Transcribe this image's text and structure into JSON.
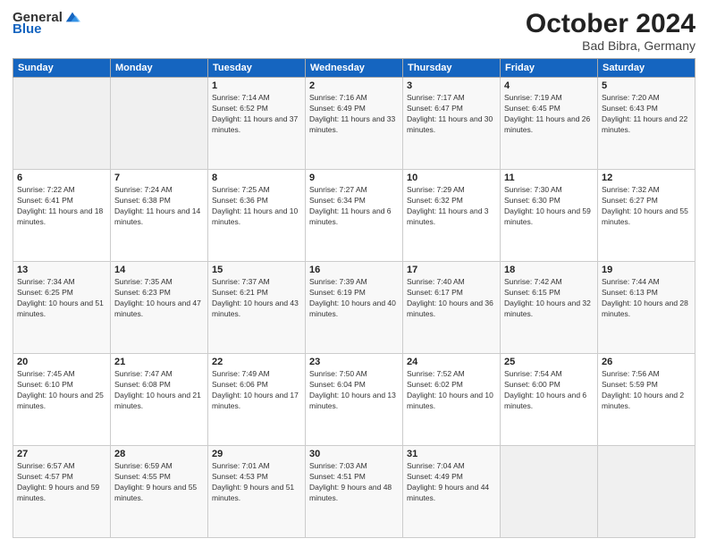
{
  "header": {
    "logo_general": "General",
    "logo_blue": "Blue",
    "month": "October 2024",
    "location": "Bad Bibra, Germany"
  },
  "days_of_week": [
    "Sunday",
    "Monday",
    "Tuesday",
    "Wednesday",
    "Thursday",
    "Friday",
    "Saturday"
  ],
  "weeks": [
    [
      {
        "day": "",
        "info": ""
      },
      {
        "day": "",
        "info": ""
      },
      {
        "day": "1",
        "info": "Sunrise: 7:14 AM\nSunset: 6:52 PM\nDaylight: 11 hours and 37 minutes."
      },
      {
        "day": "2",
        "info": "Sunrise: 7:16 AM\nSunset: 6:49 PM\nDaylight: 11 hours and 33 minutes."
      },
      {
        "day": "3",
        "info": "Sunrise: 7:17 AM\nSunset: 6:47 PM\nDaylight: 11 hours and 30 minutes."
      },
      {
        "day": "4",
        "info": "Sunrise: 7:19 AM\nSunset: 6:45 PM\nDaylight: 11 hours and 26 minutes."
      },
      {
        "day": "5",
        "info": "Sunrise: 7:20 AM\nSunset: 6:43 PM\nDaylight: 11 hours and 22 minutes."
      }
    ],
    [
      {
        "day": "6",
        "info": "Sunrise: 7:22 AM\nSunset: 6:41 PM\nDaylight: 11 hours and 18 minutes."
      },
      {
        "day": "7",
        "info": "Sunrise: 7:24 AM\nSunset: 6:38 PM\nDaylight: 11 hours and 14 minutes."
      },
      {
        "day": "8",
        "info": "Sunrise: 7:25 AM\nSunset: 6:36 PM\nDaylight: 11 hours and 10 minutes."
      },
      {
        "day": "9",
        "info": "Sunrise: 7:27 AM\nSunset: 6:34 PM\nDaylight: 11 hours and 6 minutes."
      },
      {
        "day": "10",
        "info": "Sunrise: 7:29 AM\nSunset: 6:32 PM\nDaylight: 11 hours and 3 minutes."
      },
      {
        "day": "11",
        "info": "Sunrise: 7:30 AM\nSunset: 6:30 PM\nDaylight: 10 hours and 59 minutes."
      },
      {
        "day": "12",
        "info": "Sunrise: 7:32 AM\nSunset: 6:27 PM\nDaylight: 10 hours and 55 minutes."
      }
    ],
    [
      {
        "day": "13",
        "info": "Sunrise: 7:34 AM\nSunset: 6:25 PM\nDaylight: 10 hours and 51 minutes."
      },
      {
        "day": "14",
        "info": "Sunrise: 7:35 AM\nSunset: 6:23 PM\nDaylight: 10 hours and 47 minutes."
      },
      {
        "day": "15",
        "info": "Sunrise: 7:37 AM\nSunset: 6:21 PM\nDaylight: 10 hours and 43 minutes."
      },
      {
        "day": "16",
        "info": "Sunrise: 7:39 AM\nSunset: 6:19 PM\nDaylight: 10 hours and 40 minutes."
      },
      {
        "day": "17",
        "info": "Sunrise: 7:40 AM\nSunset: 6:17 PM\nDaylight: 10 hours and 36 minutes."
      },
      {
        "day": "18",
        "info": "Sunrise: 7:42 AM\nSunset: 6:15 PM\nDaylight: 10 hours and 32 minutes."
      },
      {
        "day": "19",
        "info": "Sunrise: 7:44 AM\nSunset: 6:13 PM\nDaylight: 10 hours and 28 minutes."
      }
    ],
    [
      {
        "day": "20",
        "info": "Sunrise: 7:45 AM\nSunset: 6:10 PM\nDaylight: 10 hours and 25 minutes."
      },
      {
        "day": "21",
        "info": "Sunrise: 7:47 AM\nSunset: 6:08 PM\nDaylight: 10 hours and 21 minutes."
      },
      {
        "day": "22",
        "info": "Sunrise: 7:49 AM\nSunset: 6:06 PM\nDaylight: 10 hours and 17 minutes."
      },
      {
        "day": "23",
        "info": "Sunrise: 7:50 AM\nSunset: 6:04 PM\nDaylight: 10 hours and 13 minutes."
      },
      {
        "day": "24",
        "info": "Sunrise: 7:52 AM\nSunset: 6:02 PM\nDaylight: 10 hours and 10 minutes."
      },
      {
        "day": "25",
        "info": "Sunrise: 7:54 AM\nSunset: 6:00 PM\nDaylight: 10 hours and 6 minutes."
      },
      {
        "day": "26",
        "info": "Sunrise: 7:56 AM\nSunset: 5:59 PM\nDaylight: 10 hours and 2 minutes."
      }
    ],
    [
      {
        "day": "27",
        "info": "Sunrise: 6:57 AM\nSunset: 4:57 PM\nDaylight: 9 hours and 59 minutes."
      },
      {
        "day": "28",
        "info": "Sunrise: 6:59 AM\nSunset: 4:55 PM\nDaylight: 9 hours and 55 minutes."
      },
      {
        "day": "29",
        "info": "Sunrise: 7:01 AM\nSunset: 4:53 PM\nDaylight: 9 hours and 51 minutes."
      },
      {
        "day": "30",
        "info": "Sunrise: 7:03 AM\nSunset: 4:51 PM\nDaylight: 9 hours and 48 minutes."
      },
      {
        "day": "31",
        "info": "Sunrise: 7:04 AM\nSunset: 4:49 PM\nDaylight: 9 hours and 44 minutes."
      },
      {
        "day": "",
        "info": ""
      },
      {
        "day": "",
        "info": ""
      }
    ]
  ]
}
